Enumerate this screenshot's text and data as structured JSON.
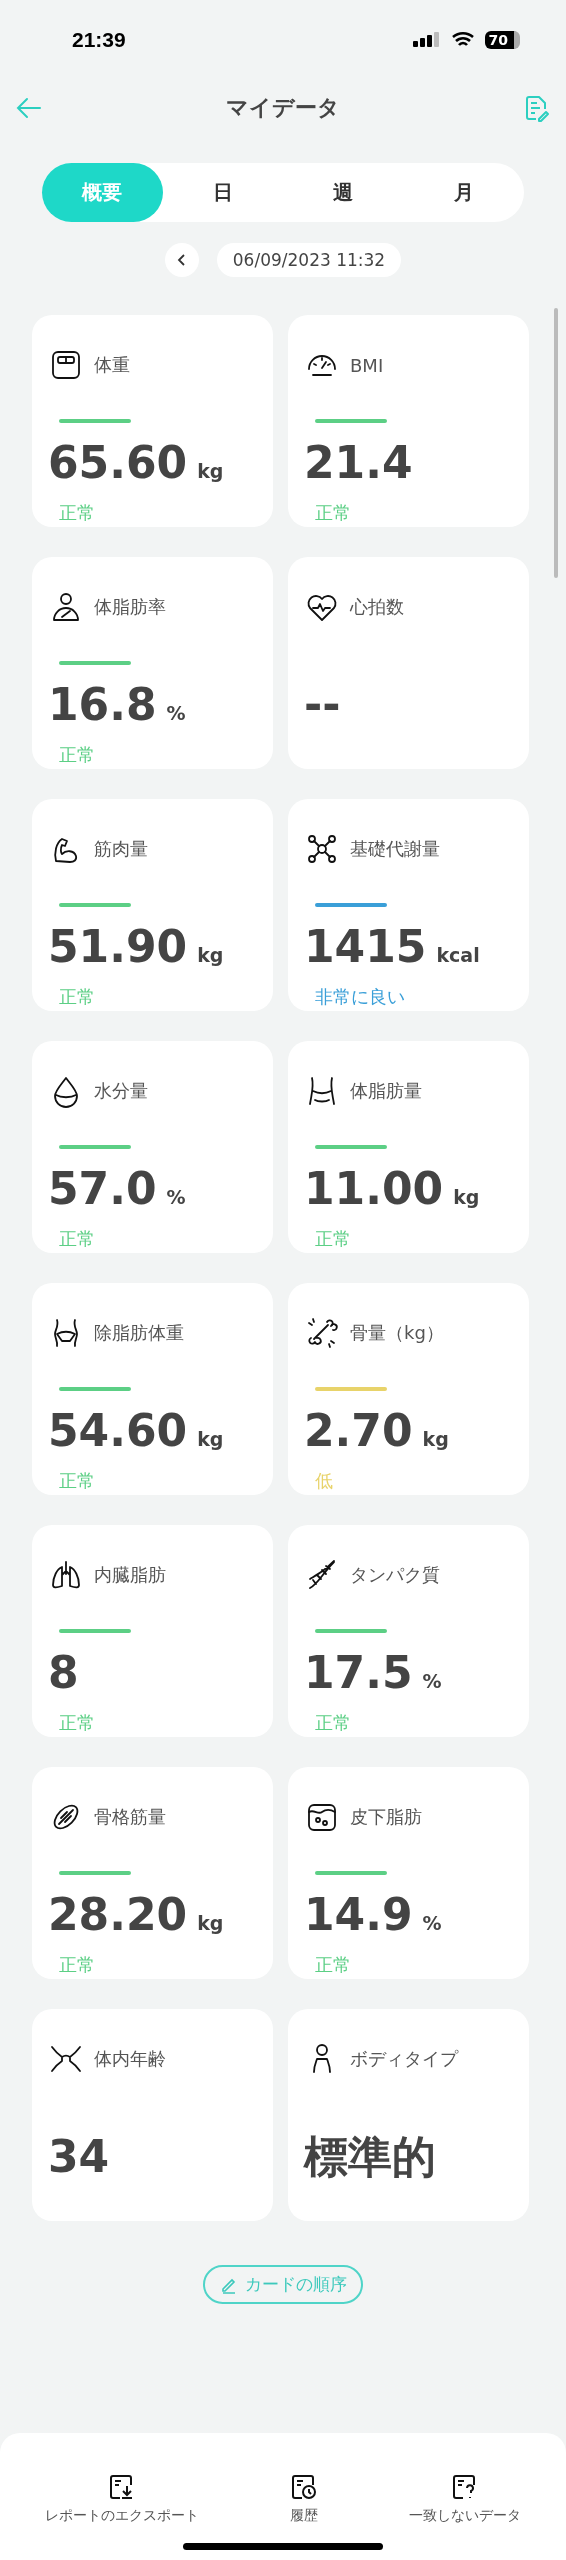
{
  "status_bar": {
    "time": "21:39",
    "battery": "70"
  },
  "header": {
    "title": "マイデータ"
  },
  "tabs": [
    {
      "label": "概要",
      "selected": true
    },
    {
      "label": "日",
      "selected": false
    },
    {
      "label": "週",
      "selected": false
    },
    {
      "label": "月",
      "selected": false
    }
  ],
  "date": "06/09/2023 11:32",
  "cards": [
    {
      "title": "体重",
      "value": "65.60",
      "unit": "kg",
      "status": "正常",
      "color": "#5ccf85"
    },
    {
      "title": "BMI",
      "value": "21.4",
      "status": "正常",
      "color": "#5ccf85"
    },
    {
      "title": "体脂肪率",
      "value": "16.8",
      "unit": "%",
      "status": "正常",
      "color": "#5ccf85"
    },
    {
      "title": "心拍数",
      "value": "--"
    },
    {
      "title": "筋肉量",
      "value": "51.90",
      "unit": "kg",
      "status": "正常",
      "color": "#5ccf85"
    },
    {
      "title": "基礎代謝量",
      "value": "1415",
      "unit": "kcal",
      "status": "非常に良い",
      "color": "#3a9fd8"
    },
    {
      "title": "水分量",
      "value": "57.0",
      "unit": "%",
      "status": "正常",
      "color": "#5ccf85"
    },
    {
      "title": "体脂肪量",
      "value": "11.00",
      "unit": "kg",
      "status": "正常",
      "color": "#5ccf85"
    },
    {
      "title": "除脂肪体重",
      "value": "54.60",
      "unit": "kg",
      "status": "正常",
      "color": "#5ccf85"
    },
    {
      "title": "骨量（kg）",
      "value": "2.70",
      "unit": "kg",
      "status": "低",
      "color": "#e8d36a"
    },
    {
      "title": "内臓脂肪",
      "value": "8",
      "status": "正常",
      "color": "#5ccf85"
    },
    {
      "title": "タンパク質",
      "value": "17.5",
      "unit": "%",
      "status": "正常",
      "color": "#5ccf85"
    },
    {
      "title": "骨格筋量",
      "value": "28.20",
      "unit": "kg",
      "status": "正常",
      "color": "#5ccf85"
    },
    {
      "title": "皮下脂肪",
      "value": "14.9",
      "unit": "%",
      "status": "正常",
      "color": "#5ccf85"
    },
    {
      "title": "体内年齢",
      "value": "34"
    },
    {
      "title": "ボディタイプ",
      "value": "標準的"
    }
  ],
  "reorder_button": "カードの順序",
  "bottom_bar": [
    {
      "label": "レポートのエクスポート"
    },
    {
      "label": "履歴"
    },
    {
      "label": "一致しないデータ"
    }
  ]
}
